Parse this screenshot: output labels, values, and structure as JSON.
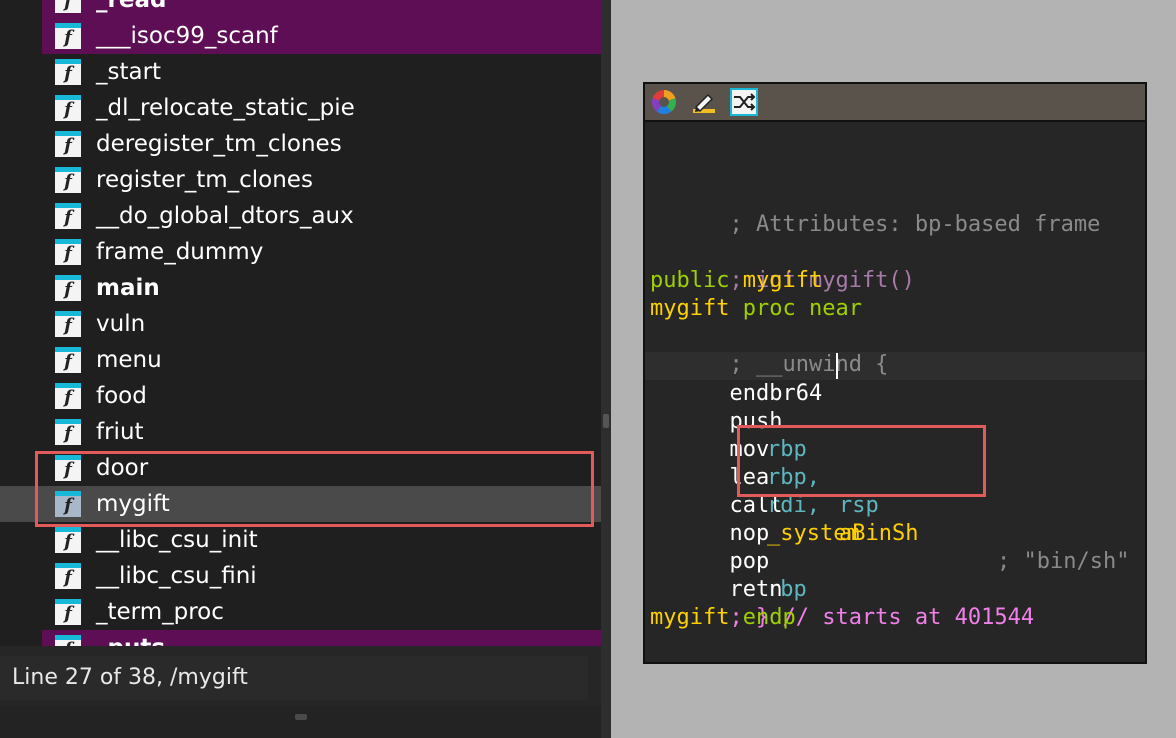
{
  "functions_panel": {
    "items": [
      {
        "name": "_read",
        "type": "import",
        "bold": true
      },
      {
        "name": "___isoc99_scanf",
        "type": "import",
        "bold": false
      },
      {
        "name": "_start",
        "type": "normal",
        "bold": false
      },
      {
        "name": "_dl_relocate_static_pie",
        "type": "normal",
        "bold": false
      },
      {
        "name": "deregister_tm_clones",
        "type": "normal",
        "bold": false
      },
      {
        "name": "register_tm_clones",
        "type": "normal",
        "bold": false
      },
      {
        "name": "__do_global_dtors_aux",
        "type": "normal",
        "bold": false
      },
      {
        "name": "frame_dummy",
        "type": "normal",
        "bold": false
      },
      {
        "name": "main",
        "type": "normal",
        "bold": true
      },
      {
        "name": "vuln",
        "type": "normal",
        "bold": false
      },
      {
        "name": "menu",
        "type": "normal",
        "bold": false
      },
      {
        "name": "food",
        "type": "normal",
        "bold": false
      },
      {
        "name": "friut",
        "type": "normal",
        "bold": false
      },
      {
        "name": "door",
        "type": "normal",
        "bold": false
      },
      {
        "name": "mygift",
        "type": "selected",
        "bold": false
      },
      {
        "name": "__libc_csu_init",
        "type": "normal",
        "bold": false
      },
      {
        "name": "__libc_csu_fini",
        "type": "normal",
        "bold": false
      },
      {
        "name": "_term_proc",
        "type": "normal",
        "bold": false
      },
      {
        "name": "_puts",
        "type": "import",
        "bold": true
      }
    ],
    "function_icon_glyph": "f",
    "status": "Line 27 of 38, /mygift"
  },
  "disassembly": {
    "toolbar": [
      "color-wheel-icon",
      "edit-pencil-icon",
      "graph-layout-icon"
    ],
    "lines": {
      "attributes": "; Attributes: bp-based frame",
      "prototype": "; int mygift()",
      "public_kw": "public",
      "public_name": "mygift",
      "proc_name": "mygift",
      "proc_kw": "proc near",
      "unwind": "; __unwind {",
      "endbr": "endbr64",
      "push_op": "push",
      "push_arg": "rbp",
      "mov_op": "mov",
      "mov_arg1": "rbp,",
      "mov_arg2": "rsp",
      "lea_op": "lea",
      "lea_reg": "rdi,",
      "lea_sym": "aBinSh",
      "lea_comment": "; \"bin/sh\"",
      "call_op": "call",
      "call_sym": "_system",
      "nop_op": "nop",
      "pop_op": "pop",
      "pop_arg": "rbp",
      "retn_op": "retn",
      "end_comment": "; } // starts at 401544",
      "endp_name": "mygift",
      "endp_kw": "endp"
    }
  },
  "colors": {
    "highlight_box": "#e25a5a",
    "import_row": "#5e0e55",
    "keyword": "#9ed000",
    "symbol": "#ffd000",
    "register": "#5fb5c0"
  }
}
